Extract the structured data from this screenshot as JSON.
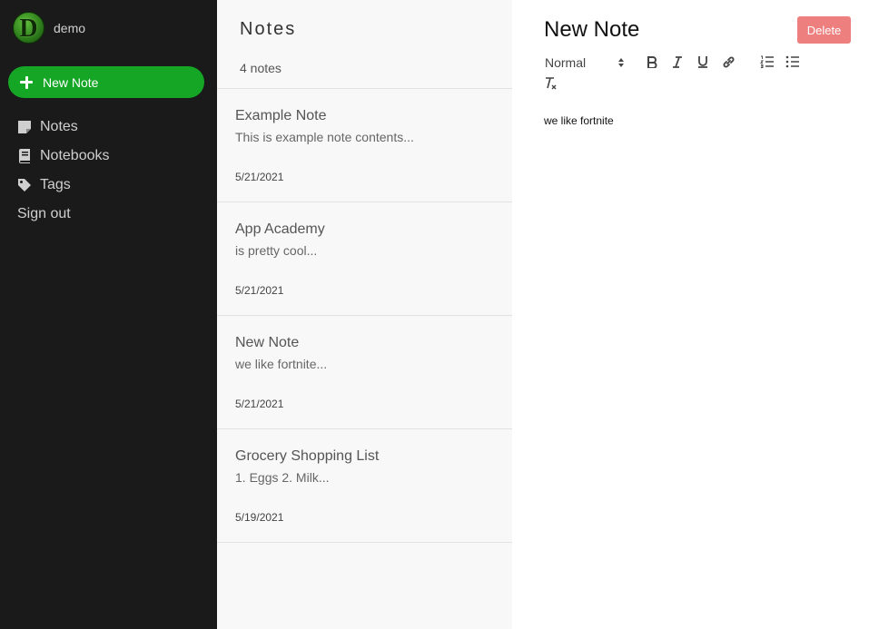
{
  "sidebar": {
    "username": "demo",
    "avatar_letter": "D",
    "new_note_label": "New Note",
    "nav": [
      {
        "label": "Notes",
        "icon": "note-icon"
      },
      {
        "label": "Notebooks",
        "icon": "book-icon"
      },
      {
        "label": "Tags",
        "icon": "tag-icon"
      },
      {
        "label": "Sign out"
      }
    ]
  },
  "notes_list": {
    "title": "Notes",
    "count": "4 notes",
    "items": [
      {
        "title": "Example Note",
        "preview": "This is example note contents...",
        "date": "5/21/2021"
      },
      {
        "title": "App Academy",
        "preview": "is pretty cool...",
        "date": "5/21/2021"
      },
      {
        "title": "New Note",
        "preview": "we like fortnite...",
        "date": "5/21/2021"
      },
      {
        "title": "Grocery Shopping List",
        "preview": "1. Eggs 2. Milk...",
        "date": "5/19/2021"
      }
    ]
  },
  "editor": {
    "title": "New Note",
    "delete_label": "Delete",
    "format_value": "Normal",
    "body": "we like fortnite"
  },
  "colors": {
    "sidebar_bg": "#1a1a1a",
    "accent_green": "#15a626",
    "delete_red": "#ee7f7f",
    "list_bg": "#f8f8f8"
  }
}
